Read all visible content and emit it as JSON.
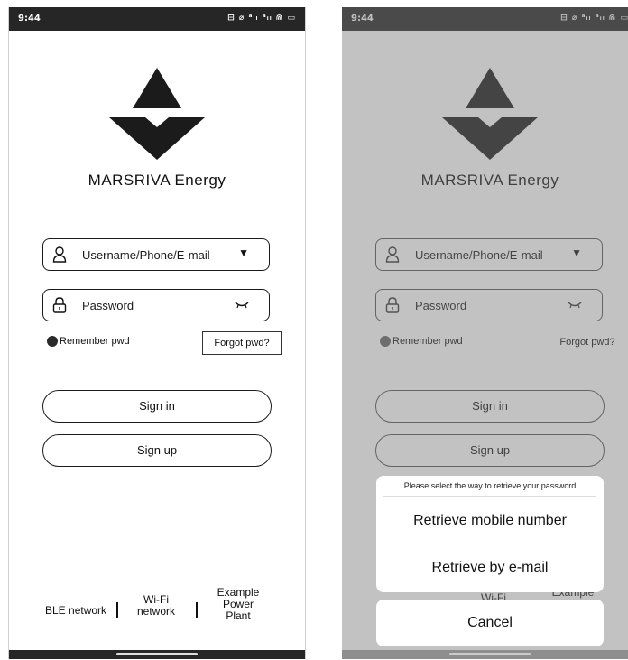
{
  "status": {
    "time": "9:44",
    "icons": "⊟ ⌀ ᵃᵢₗ ᵃᵢₗ ⋒ ▭"
  },
  "brand": {
    "name": "MARSRIVA Energy"
  },
  "login": {
    "username_placeholder": "Username/Phone/E-mail",
    "password_placeholder": "Password",
    "remember_label": "Remember pwd",
    "forgot_label": "Forgot pwd?",
    "signin_label": "Sign in",
    "signup_label": "Sign up"
  },
  "bottom": {
    "ble": "BLE network",
    "wifi": "Wi-Fi network",
    "example": "Example Power Plant",
    "wifi_partial": "Wi-Fi",
    "example_partial": "Example"
  },
  "sheet": {
    "hint": "Please select the way to retrieve your password",
    "option_mobile": "Retrieve mobile number",
    "option_email": "Retrieve by e-mail",
    "cancel": "Cancel"
  },
  "icons": {
    "user": "user-icon",
    "lock": "lock-icon",
    "dropdown": "triangle-down-icon",
    "eye": "eye-closed-icon"
  },
  "colors": {
    "statusbar": "#262626",
    "logo": "#1b1b1b",
    "overlay": "rgba(120,120,120,0.45)"
  }
}
